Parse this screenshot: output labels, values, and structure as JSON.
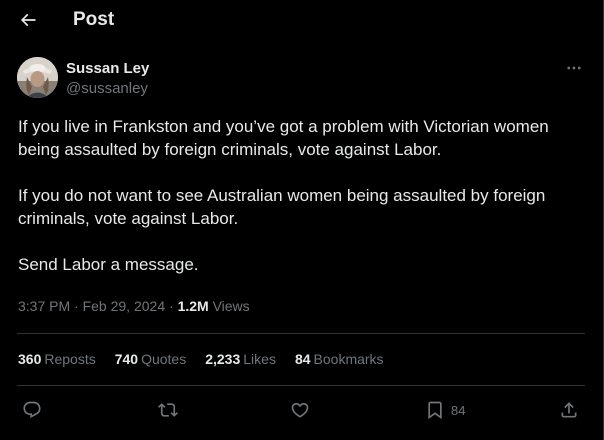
{
  "header": {
    "title": "Post"
  },
  "author": {
    "name": "Sussan Ley",
    "handle": "@sussanley"
  },
  "tweet": {
    "paragraphs": [
      "If you live in Frankston and you’ve got a problem with Victorian women being assaulted by foreign criminals, vote against Labor.",
      "If you do not want to see Australian women being assaulted by foreign criminals, vote against Labor.",
      "Send Labor a message."
    ]
  },
  "meta": {
    "time": "3:37 PM",
    "date": "Feb 29, 2024",
    "separator": "·",
    "views_count": "1.2M",
    "views_label": "Views"
  },
  "stats": {
    "reposts": {
      "count": "360",
      "label": "Reposts"
    },
    "quotes": {
      "count": "740",
      "label": "Quotes"
    },
    "likes": {
      "count": "2,233",
      "label": "Likes"
    },
    "bookmarks": {
      "count": "84",
      "label": "Bookmarks"
    }
  },
  "actions": {
    "bookmark_count": "84"
  },
  "colors": {
    "background": "#000000",
    "text_primary": "#e7e9ea",
    "text_secondary": "#71767b",
    "border": "#2f3336"
  }
}
